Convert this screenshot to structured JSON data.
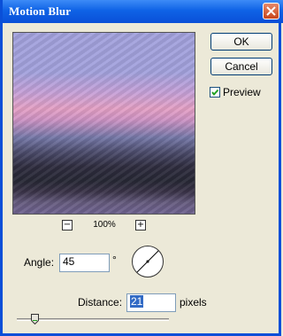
{
  "window": {
    "title": "Motion Blur"
  },
  "buttons": {
    "ok": "OK",
    "cancel": "Cancel"
  },
  "preview_option": {
    "label": "Preview",
    "checked": true
  },
  "zoom": {
    "minus": "−",
    "plus": "+",
    "level": "100%"
  },
  "angle": {
    "label": "Angle:",
    "value": "45",
    "unit": "°"
  },
  "distance": {
    "label": "Distance:",
    "value": "21",
    "unit": "pixels",
    "slider_fraction": 0.12
  },
  "colors": {
    "titlebar": "#0a4fd8",
    "close": "#c8461b",
    "selection": "#316ac5",
    "dialog_bg": "#ece9d8"
  }
}
